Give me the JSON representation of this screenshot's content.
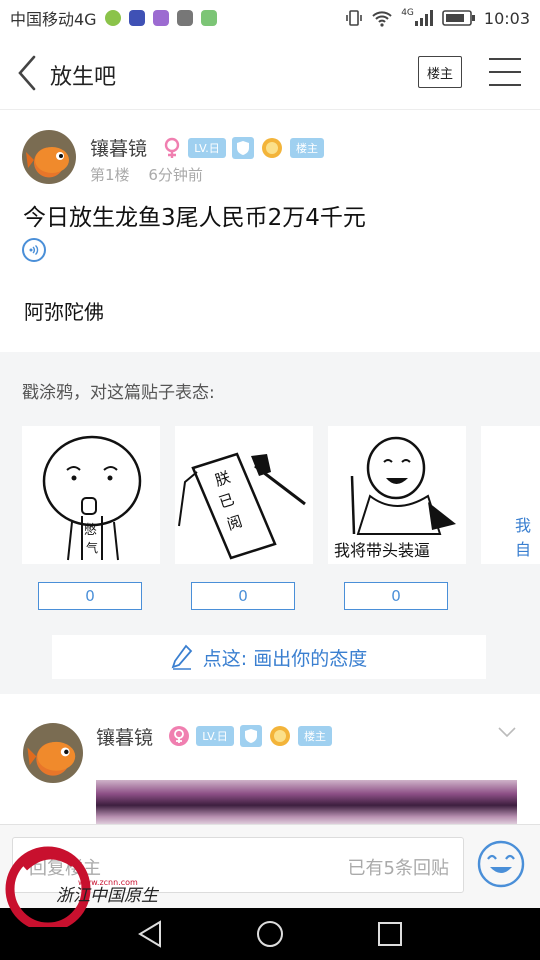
{
  "status_bar": {
    "carrier": "中国移动4G",
    "network": "4G",
    "time": "10:03"
  },
  "navbar": {
    "title": "放生吧",
    "louzhu_button": "楼主"
  },
  "post": {
    "username": "镶暮镜",
    "level_badge": "LV.日",
    "louzhu_badge": "楼主",
    "floor": "第1楼",
    "time_ago": "6分钟前",
    "title": "今日放生龙鱼3尾人民币2万4千元",
    "body": "阿弥陀佛"
  },
  "graffiti": {
    "title": "戳涂鸦，对这篇贴子表态:",
    "stickers": [
      {
        "icon": "holding-breath-face-sticker",
        "caption": "憋气",
        "count": "0"
      },
      {
        "icon": "document-signed-sticker",
        "caption": "朕已阅",
        "count": "0"
      },
      {
        "icon": "leading-the-way-sticker",
        "caption": "我将带头装逼",
        "count": "0"
      },
      {
        "caption": "我自"
      }
    ],
    "draw_button": "点这: 画出你的态度"
  },
  "reply": {
    "username": "镶暮镜",
    "level_badge": "LV.日",
    "louzhu_badge": "楼主"
  },
  "bottom": {
    "placeholder": "回复楼主",
    "reply_count": "已有5条回贴"
  },
  "watermark": {
    "text": "浙江中国原生",
    "site": "www.zcnn.com"
  },
  "colors": {
    "accent": "#3a7fd0",
    "badge_blue": "#9fd0f0",
    "gender_pink": "#f07fb0"
  }
}
